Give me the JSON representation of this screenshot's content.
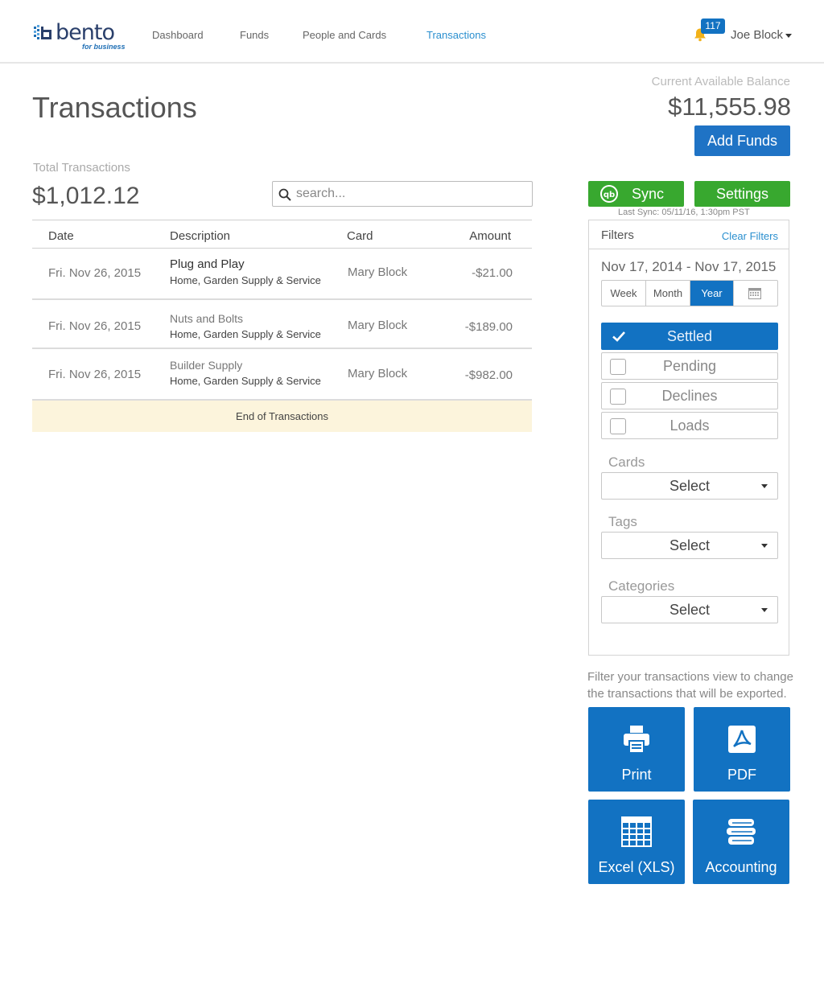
{
  "brand": {
    "name": "bento",
    "tagline": "for business"
  },
  "nav": {
    "items": [
      {
        "label": "Dashboard",
        "active": false
      },
      {
        "label": "Funds",
        "active": false
      },
      {
        "label": "People and Cards",
        "active": false
      },
      {
        "label": "Transactions",
        "active": true
      }
    ]
  },
  "header": {
    "notification_count": "117",
    "user_name": "Joe Block"
  },
  "page": {
    "title": "Transactions"
  },
  "summary": {
    "total_label": "Total Transactions",
    "total_value": "$1,012.12"
  },
  "search": {
    "placeholder": "search..."
  },
  "table": {
    "columns": [
      "Date",
      "Description",
      "Card",
      "Amount"
    ],
    "rows": [
      {
        "date": "Fri. Nov 26, 2015",
        "merchant": "Plug and Play",
        "category": "Home, Garden Supply & Service",
        "card": "Mary Block",
        "amount": "-$21.00"
      },
      {
        "date": "Fri. Nov 26, 2015",
        "merchant": "Nuts and Bolts",
        "category": "Home, Garden Supply & Service",
        "card": "Mary Block",
        "amount": "-$189.00"
      },
      {
        "date": "Fri. Nov 26, 2015",
        "merchant": "Builder Supply",
        "category": "Home, Garden Supply & Service",
        "card": "Mary Block",
        "amount": "-$982.00"
      }
    ],
    "end_label": "End of Transactions"
  },
  "balance": {
    "label": "Current Available Balance",
    "value": "$11,555.98",
    "add_funds_label": "Add Funds"
  },
  "sync": {
    "sync_label": "Sync",
    "settings_label": "Settings",
    "last_sync": "Last Sync: 05/11/16, 1:30pm PST"
  },
  "filters": {
    "title": "Filters",
    "clear_label": "Clear Filters",
    "date_range": "Nov 17, 2014 - Nov 17, 2015",
    "periods": [
      {
        "label": "Week",
        "active": false
      },
      {
        "label": "Month",
        "active": false
      },
      {
        "label": "Year",
        "active": true
      }
    ],
    "statuses": [
      {
        "label": "Settled",
        "checked": true
      },
      {
        "label": "Pending",
        "checked": false
      },
      {
        "label": "Declines",
        "checked": false
      },
      {
        "label": "Loads",
        "checked": false
      }
    ],
    "cards_label": "Cards",
    "cards_value": "Select",
    "tags_label": "Tags",
    "tags_value": "Select",
    "categories_label": "Categories",
    "categories_value": "Select"
  },
  "export": {
    "note": "Filter your transactions view to change the transactions that will be exported.",
    "print_label": "Print",
    "pdf_label": "PDF",
    "excel_label": "Excel (XLS)",
    "accounting_label": "Accounting"
  },
  "colors": {
    "primary": "#1272c2",
    "green": "#38a82f",
    "link": "#2a8fcf",
    "end_row_bg": "#fcf4dc"
  }
}
